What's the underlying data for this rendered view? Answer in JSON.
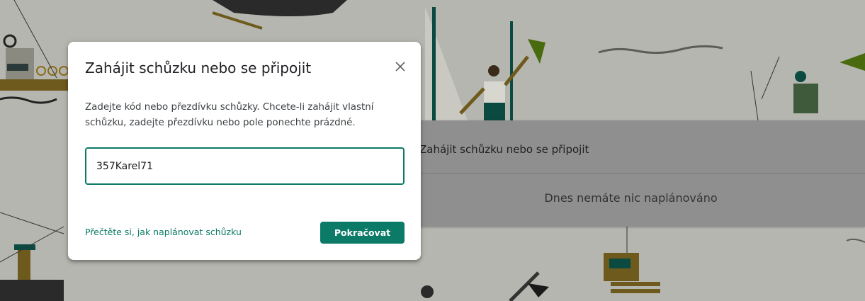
{
  "background": {
    "card_title": "Zahájit schůzku nebo se připojit",
    "card_empty_text": "Dnes nemáte nic naplánováno"
  },
  "dialog": {
    "title": "Zahájit schůzku nebo se připojit",
    "description": "Zadejte kód nebo přezdívku schůzky. Chcete-li zahájit vlastní schůzku, zadejte přezdívku nebo pole ponechte prázdné.",
    "input_value": "357Karel71",
    "help_link": "Přečtěte si, jak naplánovat schůzku",
    "continue_label": "Pokračovat",
    "close_icon": "close-icon"
  },
  "colors": {
    "accent": "#0b7a66",
    "overlay_bg": "#b9b9b3"
  }
}
